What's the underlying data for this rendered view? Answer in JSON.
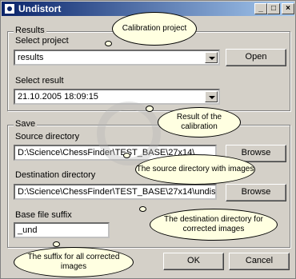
{
  "window": {
    "title": "Undistort"
  },
  "titlebar": {
    "minimize": "_",
    "maximize": "□",
    "close": "×"
  },
  "results": {
    "legend": "Results",
    "select_project_label": "Select project",
    "project_value": "results",
    "open_button": "Open",
    "select_result_label": "Select result",
    "result_value": "21.10.2005 18:09:15"
  },
  "save": {
    "legend": "Save",
    "source_label": "Source directory",
    "source_value": "D:\\Science\\ChessFinder\\TEST_BASE\\27x14\\",
    "browse_source": "Browse",
    "dest_label": "Destination directory",
    "dest_value": "D:\\Science\\ChessFinder\\TEST_BASE\\27x14\\undis",
    "browse_dest": "Browse",
    "suffix_label": "Base file suffix",
    "suffix_value": "_und"
  },
  "buttons": {
    "ok": "OK",
    "cancel": "Cancel"
  },
  "callouts": {
    "calibration_project": "Calibration project",
    "result_calibration": "Result of the calibration",
    "source_images": "The source directory with images",
    "dest_corrected": "The destination directory for corrected images",
    "suffix_corrected": "The suffix for all corrected images"
  }
}
